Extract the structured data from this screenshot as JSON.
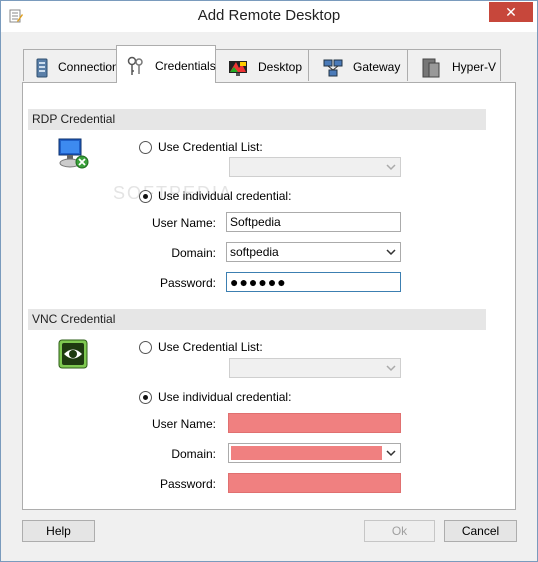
{
  "window": {
    "title": "Add Remote Desktop",
    "close_glyph": "✕"
  },
  "tabs": [
    {
      "label": "Connection",
      "icon": "connection-icon"
    },
    {
      "label": "Credentials",
      "icon": "credentials-icon",
      "active": true
    },
    {
      "label": "Desktop",
      "icon": "desktop-icon"
    },
    {
      "label": "Gateway",
      "icon": "gateway-icon"
    },
    {
      "label": "Hyper-V",
      "icon": "hyper-v-icon"
    }
  ],
  "rdp": {
    "header": "RDP Credential",
    "use_list_label": "Use Credential List:",
    "use_individual_label": "Use individual credential:",
    "username_label": "User Name:",
    "username_value": "Softpedia",
    "domain_label": "Domain:",
    "domain_value": "softpedia",
    "password_label": "Password:",
    "password_value": "●●●●●●",
    "selected": "individual"
  },
  "vnc": {
    "header": "VNC Credential",
    "use_list_label": "Use Credential List:",
    "use_individual_label": "Use individual credential:",
    "username_label": "User Name:",
    "username_value": "",
    "domain_label": "Domain:",
    "domain_value": "",
    "password_label": "Password:",
    "password_value": "",
    "selected": "individual",
    "error_color": "#f08080"
  },
  "watermark": "SOFTPEDIA",
  "buttons": {
    "help": "Help",
    "ok": "Ok",
    "cancel": "Cancel"
  }
}
